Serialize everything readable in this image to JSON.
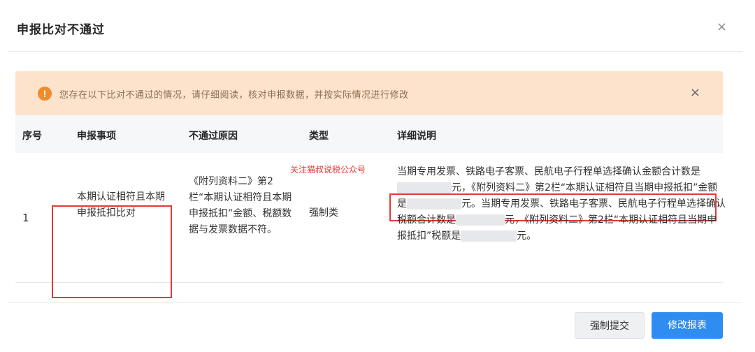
{
  "dialog": {
    "title": "申报比对不通过",
    "close_glyph": "×"
  },
  "alert": {
    "icon_glyph": "!",
    "text": "您存在以下比对不通过的情况，请仔细阅读，核对申报数据，并按实际情况进行修改",
    "close_glyph": "×",
    "bg_color": "#fde2cc",
    "icon_color": "#f08c2b"
  },
  "table": {
    "headers": {
      "no": "序号",
      "item": "申报事项",
      "reason": "不通过原因",
      "type": "类型",
      "detail": "详细说明"
    },
    "rows": [
      {
        "no": "1",
        "item": "本期认证相符且本期申报抵扣比对",
        "reason": "《附列资料二》第2栏“本期认证相符且本期申报抵扣”金额、税额数据与发票数据不符。",
        "type": "强制类",
        "detail": {
          "p1": "当期专用发票、铁路电子客票、民航电子行程单选择确认金额合计数是",
          "p2": "元，《附列资料二》第2栏“本期认证相符且当期申报抵扣”金额是",
          "p3": "元。当期专用发票、铁路电子客票、民航电子行程单选择确认税额合计数是",
          "p4": "元，《附列资料二》第2栏“本期认证相符且当期申报抵扣”税额是",
          "p5": "元。"
        }
      }
    ]
  },
  "watermark": "关注猫叔说税公众号",
  "footer": {
    "force_submit_label": "强制提交",
    "edit_report_label": "修改报表",
    "primary_color": "#2f8cf0"
  },
  "highlight_color": "#e53935"
}
